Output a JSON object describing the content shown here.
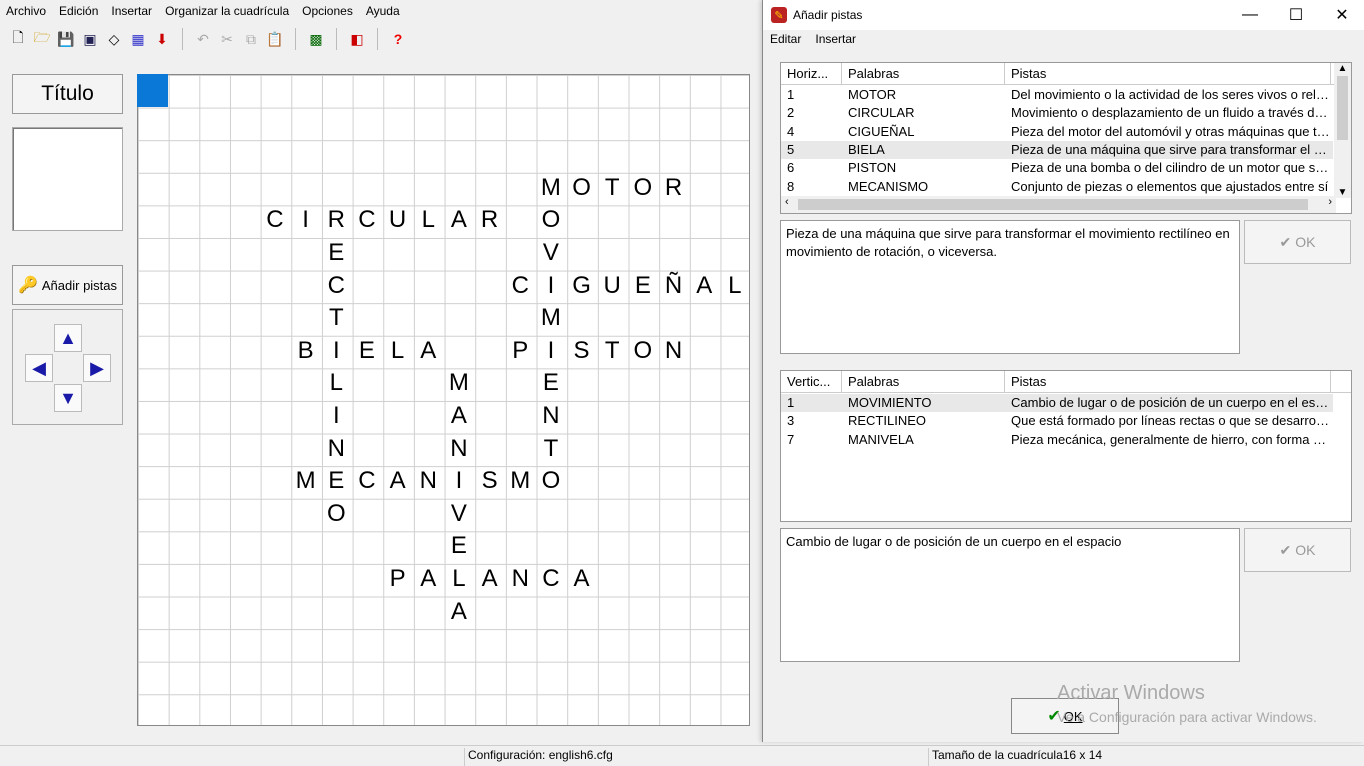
{
  "menu": [
    "Archivo",
    "Edición",
    "Insertar",
    "Organizar la cuadrícula",
    "Opciones",
    "Ayuda"
  ],
  "toolbar_icons": [
    "new-icon",
    "open-icon",
    "save-icon",
    "save-as-icon",
    "eraser-icon",
    "web-icon",
    "export-icon",
    "undo-icon",
    "cut-icon",
    "copy-icon",
    "paste-icon",
    "grid-icon",
    "palette-icon",
    "help-icon"
  ],
  "left": {
    "title_button": "Título",
    "add_clues_button": "Añadir pistas"
  },
  "crossword": [
    {
      "word": "MOTOR",
      "row": 3,
      "col": 13,
      "dir": "h"
    },
    {
      "word": "CIRCULAR",
      "row": 4,
      "col": 4,
      "dir": "h"
    },
    {
      "word": "CIGUEÑAL",
      "row": 6,
      "col": 12,
      "dir": "h"
    },
    {
      "word": "BIELA",
      "row": 8,
      "col": 5,
      "dir": "h"
    },
    {
      "word": "PISTON",
      "row": 8,
      "col": 12,
      "dir": "h"
    },
    {
      "word": "MECANISMO",
      "row": 12,
      "col": 5,
      "dir": "h"
    },
    {
      "word": "PALANCA",
      "row": 15,
      "col": 8,
      "dir": "h"
    },
    {
      "word": "MOVIMIENTO",
      "row": 3,
      "col": 13,
      "dir": "v"
    },
    {
      "word": "RECTILINEO",
      "row": 4,
      "col": 6,
      "dir": "v"
    },
    {
      "word": "MANIVELA",
      "row": 9,
      "col": 10,
      "dir": "v"
    }
  ],
  "status": {
    "config": "Configuración: english6.cfg",
    "grid_size": "Tamaño de la cuadrícula16 x 14"
  },
  "dialog": {
    "title": "Añadir pistas",
    "menu": [
      "Editar",
      "Insertar"
    ],
    "horizontal": {
      "headers": [
        "Horiz...",
        "Palabras",
        "Pistas"
      ],
      "rows": [
        {
          "n": "1",
          "word": "MOTOR",
          "clue": "Del movimiento o la actividad de los seres vivos o relativo a ellos"
        },
        {
          "n": "2",
          "word": "CIRCULAR",
          "clue": "Movimiento  o desplazamiento de un  fluido a través de un conducto"
        },
        {
          "n": "4",
          "word": "CIGUEÑAL",
          "clue": "Pieza del motor del automóvil y otras máquinas que transforma"
        },
        {
          "n": "5",
          "word": "BIELA",
          "clue": "Pieza de una máquina que sirve para transformar el movimiento"
        },
        {
          "n": "6",
          "word": "PISTON",
          "clue": "Pieza de una bomba o del cilindro de un motor que se mueve"
        },
        {
          "n": "8",
          "word": "MECANISMO",
          "clue": "Conjunto de piezas o elementos que ajustados entre sí"
        }
      ],
      "clue_text": "Pieza de una máquina que sirve para transformar el movimiento rectilíneo en movimiento de rotación, o viceversa.",
      "ok": "OK"
    },
    "vertical": {
      "headers": [
        "Vertic...",
        "Palabras",
        "Pistas"
      ],
      "rows": [
        {
          "n": "1",
          "word": "MOVIMIENTO",
          "clue": "Cambio de lugar o de posición de un cuerpo en el espacio"
        },
        {
          "n": "3",
          "word": "RECTILINEO",
          "clue": "Que está formado por líneas rectas o que se desarrolla en línea recta"
        },
        {
          "n": "7",
          "word": "MANIVELA",
          "clue": "Pieza mecánica, generalmente de hierro, con forma de codo"
        }
      ],
      "clue_text": "Cambio de lugar o de posición de un cuerpo en el espacio",
      "ok": "OK"
    },
    "watermark_1": "Activar Windows",
    "watermark_2": "Ve a Configuración para activar Windows.",
    "main_ok": "OK"
  }
}
